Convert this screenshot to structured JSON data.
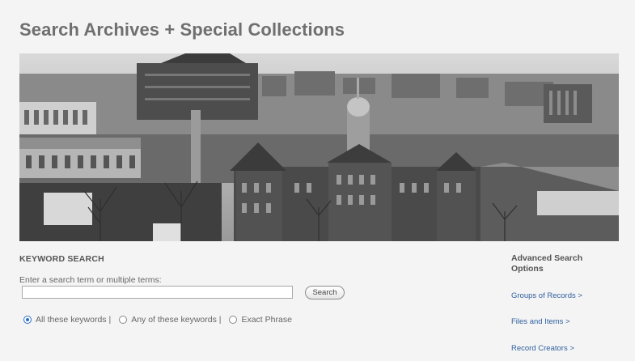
{
  "page_title": "Search Archives + Special Collections",
  "keyword_search": {
    "heading": "KEYWORD SEARCH",
    "hint": "Enter a search term or multiple terms:",
    "input_value": "",
    "button_label": "Search",
    "options": [
      {
        "label": "All these keywords |",
        "checked": true
      },
      {
        "label": "Any of these keywords |",
        "checked": false
      },
      {
        "label": "Exact Phrase",
        "checked": false
      }
    ]
  },
  "advanced": {
    "heading": "Advanced Search Options",
    "links": [
      {
        "label": "Groups of Records >"
      },
      {
        "label": "Files and Items >"
      },
      {
        "label": "Record Creators >"
      }
    ]
  },
  "colors": {
    "link": "#2f5f9e",
    "radio_selected": "#2a6fc9",
    "title": "#6f6f6f"
  }
}
